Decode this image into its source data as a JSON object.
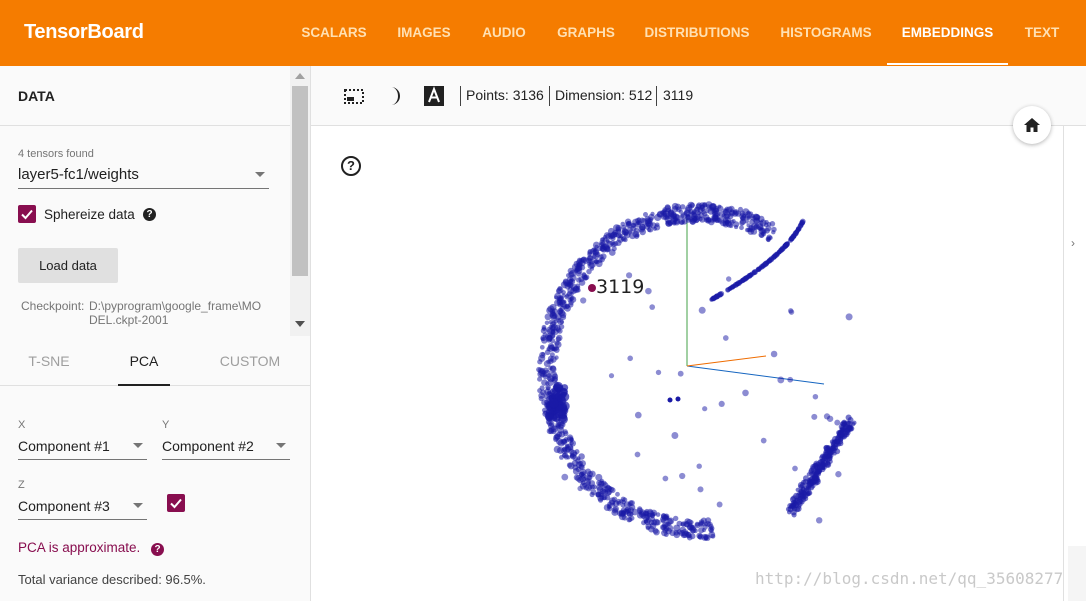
{
  "app": {
    "title": "TensorBoard",
    "accent_color": "#f57c00",
    "nav_tabs": [
      {
        "label": "SCALARS",
        "active": false
      },
      {
        "label": "IMAGES",
        "active": false
      },
      {
        "label": "AUDIO",
        "active": false
      },
      {
        "label": "GRAPHS",
        "active": false
      },
      {
        "label": "DISTRIBUTIONS",
        "active": false
      },
      {
        "label": "HISTOGRAMS",
        "active": false
      },
      {
        "label": "EMBEDDINGS",
        "active": true
      },
      {
        "label": "TEXT",
        "active": false
      }
    ]
  },
  "sidebar": {
    "data_heading": "DATA",
    "tensors_found": "4 tensors found",
    "tensor_selected": "layer5-fc1/weights",
    "sphereize_label": "Sphereize data",
    "sphereize_checked": true,
    "load_button": "Load data",
    "checkpoint_label": "Checkpoint:",
    "checkpoint_path": "D:\\pyprogram\\google_frame\\MODEL.ckpt-2001",
    "projection_tabs": [
      {
        "label": "T-SNE",
        "active": false
      },
      {
        "label": "PCA",
        "active": true
      },
      {
        "label": "CUSTOM",
        "active": false
      }
    ],
    "pca": {
      "x_label": "X",
      "x_value": "Component #1",
      "y_label": "Y",
      "y_value": "Component #2",
      "z_label": "Z",
      "z_value": "Component #3",
      "z_enabled": true,
      "approx_note": "PCA is approximate.",
      "variance_text": "Total variance described: 96.5%."
    },
    "checkbox_color": "#880e4f"
  },
  "toolbar": {
    "select_icon": "selection-box-icon",
    "night_mode_icon": "night-mode-icon",
    "labels_icon": "label-toggle-icon",
    "points_text": "Points: 3136",
    "dimension_text": "Dimension: 512",
    "selected_id": "3119"
  },
  "plot": {
    "highlighted_label": "3119",
    "point_color": "#1a1aa6",
    "axis_colors": {
      "x": "#1565c0",
      "y": "#43a047",
      "z": "#ef6c00"
    }
  },
  "watermark": "http://blog.csdn.net/qq_35608277"
}
